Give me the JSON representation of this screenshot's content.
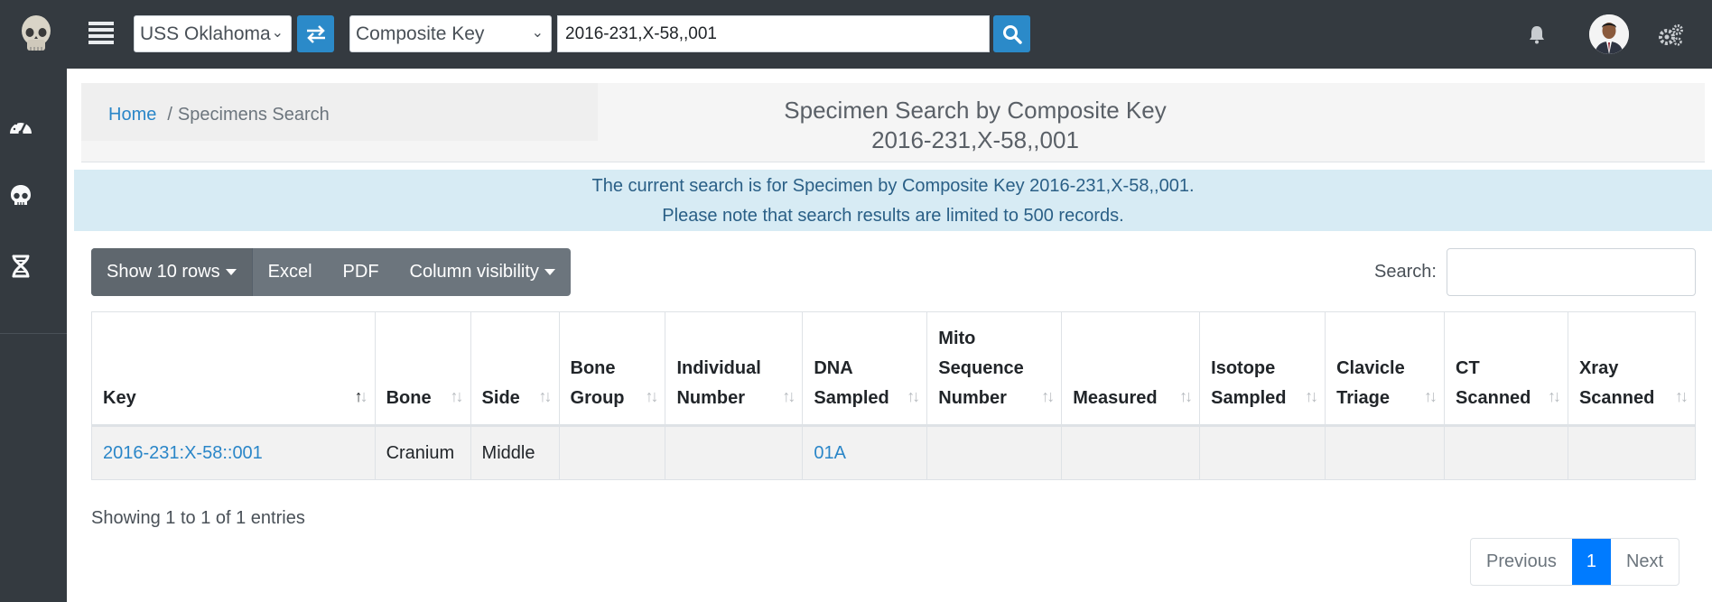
{
  "navbar": {
    "ship_select": "USS Oklahoma",
    "search_type": "Composite Key",
    "search_value": "2016-231,X-58,,001"
  },
  "breadcrumb": {
    "home": "Home",
    "separator": "/",
    "current": "Specimens Search"
  },
  "page_title": {
    "line1": "Specimen Search by Composite Key",
    "line2": "2016-231,X-58,,001"
  },
  "alert": {
    "line1": "The current search is for Specimen by Composite Key 2016-231,X-58,,001.",
    "line2": "Please note that search results are limited to 500 records."
  },
  "toolbar": {
    "show_rows": "Show 10 rows",
    "excel": "Excel",
    "pdf": "PDF",
    "column_visibility": "Column visibility",
    "search_label": "Search:"
  },
  "table": {
    "columns": [
      {
        "lines": [
          "Key"
        ]
      },
      {
        "lines": [
          "Bone"
        ]
      },
      {
        "lines": [
          "Side"
        ]
      },
      {
        "lines": [
          "Bone",
          "Group"
        ]
      },
      {
        "lines": [
          "Individual",
          "Number"
        ]
      },
      {
        "lines": [
          "DNA",
          "Sampled"
        ]
      },
      {
        "lines": [
          "Mito",
          "Sequence",
          "Number"
        ]
      },
      {
        "lines": [
          "Measured"
        ]
      },
      {
        "lines": [
          "Isotope",
          "Sampled"
        ]
      },
      {
        "lines": [
          "Clavicle",
          "Triage"
        ]
      },
      {
        "lines": [
          "CT",
          "Scanned"
        ]
      },
      {
        "lines": [
          "Xray",
          "Scanned"
        ]
      }
    ],
    "rows": [
      {
        "key": "2016-231:X-58::001",
        "bone": "Cranium",
        "side": "Middle",
        "bone_group": "",
        "individual_number": "",
        "dna_sampled": "01A",
        "mito_sequence_number": "",
        "measured": "",
        "isotope_sampled": "",
        "clavicle_triage": "",
        "ct_scanned": "",
        "xray_scanned": ""
      }
    ]
  },
  "info": "Showing 1 to 1 of 1 entries",
  "pagination": {
    "previous": "Previous",
    "current": "1",
    "next": "Next"
  },
  "colors": {
    "navbar_bg": "#343a40",
    "accent_blue": "#2b8ac9",
    "link": "#2a86c8",
    "alert_bg": "#d7ebf4",
    "pager_active": "#007bff"
  },
  "icons": {
    "logo": "skull-logo-icon",
    "menu": "hamburger-icon",
    "swap": "swap-arrows-icon",
    "search": "search-icon",
    "bell": "bell-icon",
    "settings": "gears-icon",
    "sidebar": [
      "dashboard-gauge-icon",
      "skull-icon",
      "dna-icon"
    ]
  }
}
